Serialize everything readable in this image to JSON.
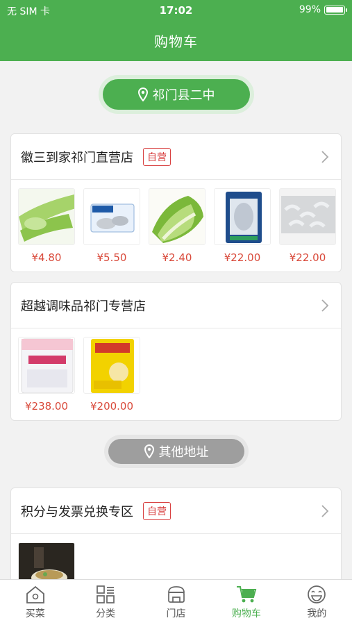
{
  "status_bar": {
    "carrier": "无 SIM 卡",
    "time": "17:02",
    "battery": "99%",
    "battery_level": 0.99
  },
  "header": {
    "title": "购物车"
  },
  "location_primary": {
    "label": "祁门县二中"
  },
  "location_other": {
    "label": "其他地址"
  },
  "stores": [
    {
      "name": "徽三到家祁门直营店",
      "badge": "自营",
      "items": [
        {
          "image": "celery-image",
          "price": "¥4.80"
        },
        {
          "image": "frozen-fish-package-image",
          "price": "¥5.50"
        },
        {
          "image": "napa-cabbage-image",
          "price": "¥2.40"
        },
        {
          "image": "fish-fillet-package-image",
          "price": "¥22.00"
        },
        {
          "image": "frozen-shrimp-image",
          "price": "¥22.00"
        }
      ]
    },
    {
      "name": "超越调味品祁门专营店",
      "items": [
        {
          "image": "msg-bag-image",
          "price": "¥238.00"
        },
        {
          "image": "seasoning-bag-image",
          "price": "¥200.00"
        }
      ]
    },
    {
      "name": "积分与发票兑换专区",
      "badge": "自营",
      "items": [
        {
          "image": "food-bowl-image",
          "price": ""
        }
      ]
    }
  ],
  "tabs": [
    {
      "label": "买菜",
      "icon": "home-icon",
      "active": false
    },
    {
      "label": "分类",
      "icon": "category-grid-icon",
      "active": false
    },
    {
      "label": "门店",
      "icon": "store-icon",
      "active": false
    },
    {
      "label": "购物车",
      "icon": "cart-icon",
      "active": true
    },
    {
      "label": "我的",
      "icon": "smiley-icon",
      "active": false
    }
  ],
  "colors": {
    "brand_green": "#4caf50",
    "price_red": "#d94a3b",
    "badge_red": "#d84040",
    "pill_gray": "#9e9e9e"
  }
}
